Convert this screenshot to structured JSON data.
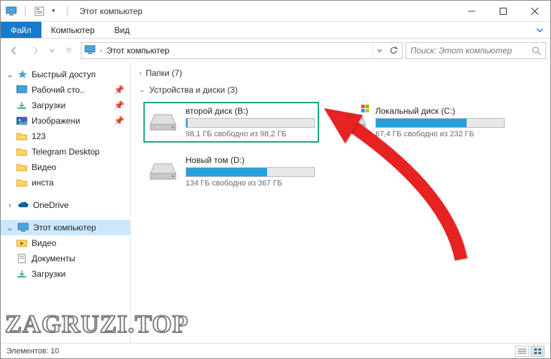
{
  "titlebar": {
    "title": "Этот компьютер"
  },
  "ribbon": {
    "file": "Файл",
    "computer": "Компьютер",
    "view": "Вид"
  },
  "address": {
    "path": "Этот компьютер"
  },
  "search": {
    "placeholder": "Поиск: Этот компьютер"
  },
  "sidebar": {
    "quick_access": "Быстрый доступ",
    "items": [
      {
        "label": "Рабочий сто..",
        "icon": "desktop"
      },
      {
        "label": "Загрузки",
        "icon": "downloads"
      },
      {
        "label": "Изображени",
        "icon": "pictures"
      },
      {
        "label": "123",
        "icon": "folder"
      },
      {
        "label": "Telegram Desktop",
        "icon": "folder"
      },
      {
        "label": "Видео",
        "icon": "folder"
      },
      {
        "label": "инста",
        "icon": "folder"
      }
    ],
    "onedrive": "OneDrive",
    "this_pc": "Этот компьютер",
    "pc_items": [
      {
        "label": "Видео"
      },
      {
        "label": "Документы"
      },
      {
        "label": "Загрузки"
      }
    ]
  },
  "groups": {
    "folders": "Папки (7)",
    "drives": "Устройства и диски (3)"
  },
  "drives": [
    {
      "name": "второй диск (B:)",
      "info": "98,1 ГБ свободно из 98,2 ГБ",
      "fill": 1,
      "highlighted": true,
      "os": false
    },
    {
      "name": "Локальный диск (C:)",
      "info": "67,4 ГБ свободно из 232 ГБ",
      "fill": 71,
      "highlighted": false,
      "os": true
    },
    {
      "name": "Новый том (D:)",
      "info": "134 ГБ свободно из 367 ГБ",
      "fill": 63,
      "highlighted": false,
      "os": false
    }
  ],
  "statusbar": {
    "elements": "Элементов: 10"
  },
  "watermark": "ZAGRUZI.TOP"
}
